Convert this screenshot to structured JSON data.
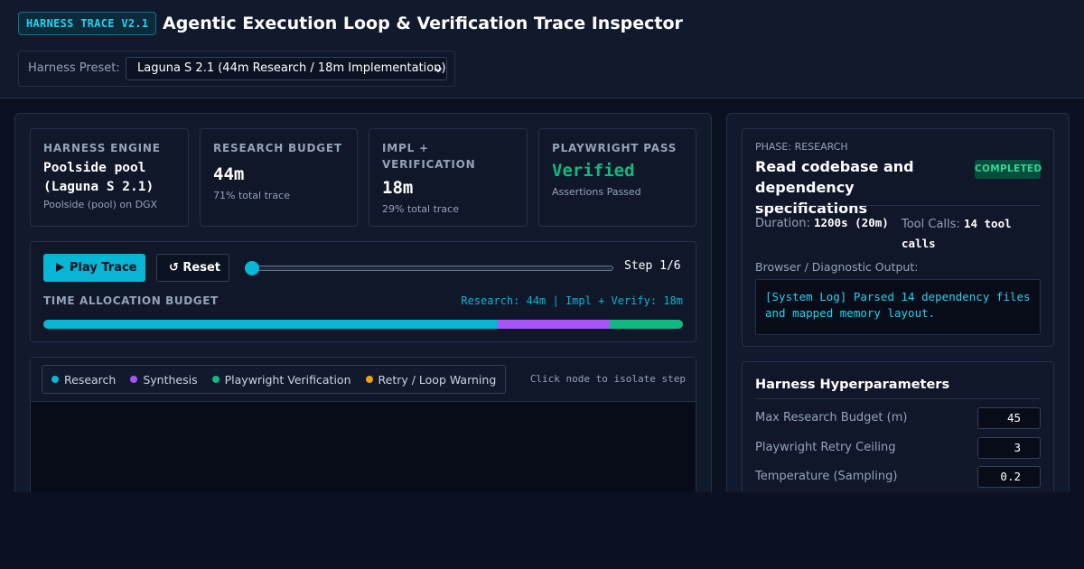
{
  "header": {
    "version_badge": "HARNESS TRACE V2.1",
    "title": "Agentic Execution Loop & Verification Trace Inspector",
    "preset_label": "Harness Preset:",
    "preset_value": "Laguna S 2.1 (44m Research / 18m Implementation)"
  },
  "stats": {
    "engine": {
      "label": "HARNESS ENGINE",
      "value_line1": "Poolside pool",
      "value_line2": "(Laguna S 2.1)",
      "sub": "Poolside (pool) on DGX"
    },
    "research": {
      "label": "RESEARCH BUDGET",
      "value": "44m",
      "sub": "71% total trace"
    },
    "impl": {
      "label_line1": "IMPL +",
      "label_line2": "VERIFICATION",
      "value": "18m",
      "sub": "29% total trace"
    },
    "playwright": {
      "label": "PLAYWRIGHT PASS",
      "value": "Verified",
      "sub": "Assertions Passed"
    }
  },
  "controls": {
    "play_label": "Play Trace",
    "reset_label": "↺ Reset",
    "step_text": "Step 1/6",
    "slider_fraction": 0,
    "budget_label": "TIME ALLOCATION BUDGET",
    "budget_summary": "Research: 44m | Impl + Verify: 18m",
    "budget_segments": [
      {
        "name": "Research",
        "fraction": 0.71,
        "color": "#06b6d4"
      },
      {
        "name": "Synthesis",
        "fraction": 0.175,
        "color": "#a855f7"
      },
      {
        "name": "Playwright Verification",
        "fraction": 0.115,
        "color": "#10b981"
      }
    ]
  },
  "graph": {
    "legend": [
      {
        "label": "Research",
        "color": "#06b6d4"
      },
      {
        "label": "Synthesis",
        "color": "#a855f7"
      },
      {
        "label": "Playwright Verification",
        "color": "#10b981"
      },
      {
        "label": "Retry / Loop Warning",
        "color": "#f59e0b"
      }
    ],
    "hint": "Click node to isolate step"
  },
  "phase": {
    "label": "PHASE: RESEARCH",
    "title": "Read codebase and dependency specifications",
    "status": "COMPLETED",
    "duration_label": "Duration:",
    "duration_value": "1200s (20m)",
    "tool_calls_label": "Tool Calls:",
    "tool_calls_value": "14 tool calls",
    "output_label": "Browser / Diagnostic Output:",
    "output_text": "[System Log] Parsed 14 dependency files and mapped memory layout."
  },
  "hyper": {
    "title": "Harness Hyperparameters",
    "rows": [
      {
        "label": "Max Research Budget (m)",
        "value": "45"
      },
      {
        "label": "Playwright Retry Ceiling",
        "value": "3"
      },
      {
        "label": "Temperature (Sampling)",
        "value": "0.2"
      }
    ]
  }
}
